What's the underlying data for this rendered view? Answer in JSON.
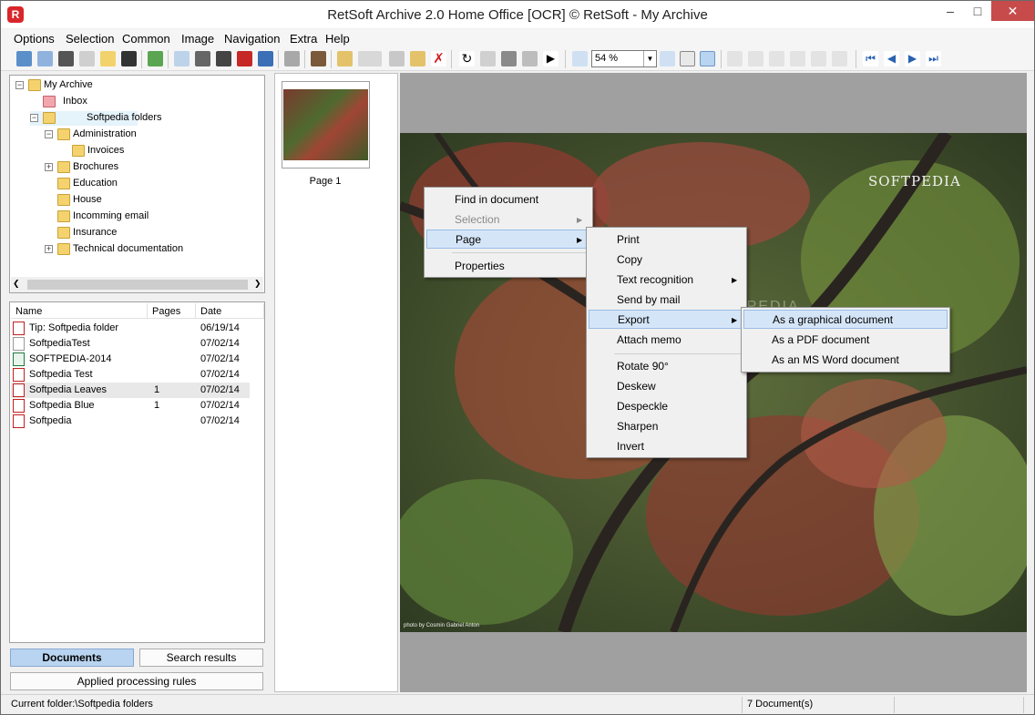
{
  "window": {
    "title": "RetSoft Archive 2.0 Home Office [OCR] © RetSoft - My Archive",
    "app_icon": "R"
  },
  "menubar": [
    "Options",
    "Selection",
    "Common",
    "Image",
    "Navigation",
    "Extra",
    "Help"
  ],
  "toolbar": {
    "zoom_value": "54 %"
  },
  "tree": {
    "items": [
      {
        "label": "My Archive",
        "expander": "−"
      },
      {
        "label": "Inbox"
      },
      {
        "label": "Softpedia folders",
        "expander": "−"
      },
      {
        "label": "Administration",
        "expander": "−"
      },
      {
        "label": "Invoices"
      },
      {
        "label": "Brochures",
        "expander": "+"
      },
      {
        "label": "Education"
      },
      {
        "label": "House"
      },
      {
        "label": "Incomming email"
      },
      {
        "label": "Insurance"
      },
      {
        "label": "Technical documentation",
        "expander": "+"
      }
    ]
  },
  "doclist": {
    "columns": [
      "Name",
      "Pages",
      "Date"
    ],
    "rows": [
      {
        "name": "Tip: Softpedia folder",
        "pages": "",
        "date": "06/19/14",
        "icon": "pdf"
      },
      {
        "name": "SoftpediaTest",
        "pages": "",
        "date": "07/02/14",
        "icon": "doc"
      },
      {
        "name": "SOFTPEDIA-2014",
        "pages": "",
        "date": "07/02/14",
        "icon": "xls"
      },
      {
        "name": "Softpedia Test",
        "pages": "",
        "date": "07/02/14",
        "icon": "pdf"
      },
      {
        "name": "Softpedia Leaves",
        "pages": "1",
        "date": "07/02/14",
        "icon": "img"
      },
      {
        "name": "Softpedia Blue",
        "pages": "1",
        "date": "07/02/14",
        "icon": "img"
      },
      {
        "name": "Softpedia",
        "pages": "",
        "date": "07/02/14",
        "icon": "pdf"
      }
    ]
  },
  "tabs": {
    "documents": "Documents",
    "search": "Search results",
    "rules": "Applied processing rules"
  },
  "thumbnail": {
    "label": "Page 1"
  },
  "viewer": {
    "watermark": "SOFTPEDIA",
    "watermark2": "SOFTPEDIA",
    "credit": "photo by Cosmin Gabriel Anton"
  },
  "menu1": {
    "items": [
      "Find in document",
      "Selection",
      "Page",
      "Properties"
    ]
  },
  "menu2": {
    "items": [
      "Print",
      "Copy",
      "Text recognition",
      "Send by mail",
      "Export",
      "Attach memo",
      "Rotate 90°",
      "Deskew",
      "Despeckle",
      "Sharpen",
      "Invert"
    ]
  },
  "menu3": {
    "items": [
      "As a graphical document",
      "As a PDF document",
      "As an MS Word document"
    ]
  },
  "status": {
    "folder": "Current folder:\\Softpedia folders",
    "count": "7 Document(s)"
  },
  "colors": {
    "accent": "#b9d4f0",
    "highlight": "#d5e5f8",
    "close": "#c74b4b"
  }
}
